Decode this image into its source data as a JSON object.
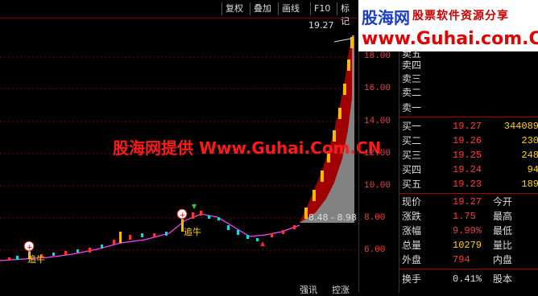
{
  "toolbar": {
    "items": [
      "复权",
      "叠加",
      "画线",
      "F10",
      "标记"
    ]
  },
  "logo": {
    "brand": "股海网",
    "slogan": "股票软件资源分享",
    "url": "www.Guhai.com.CN"
  },
  "chart": {
    "peak_label": "19.27",
    "range_label": "8.48 - 8.98",
    "signal_tags": [
      "追牛",
      "追牛"
    ],
    "bottom_tags": [
      "强讯",
      "控涨"
    ],
    "watermark": "股海网提供 Www.Guhai.Com.CN",
    "colors": {
      "up": "#ff3333",
      "down": "#00e0e0",
      "ma": "#ff44ff",
      "fill": "#a00000",
      "gold": "#ffb800"
    }
  },
  "price_axis": {
    "labels": [
      "18.00",
      "16.00",
      "14.00",
      "12.00",
      "10.00",
      "8.00",
      "6.00"
    ]
  },
  "quotes": {
    "sell": [
      {
        "label": "卖五",
        "price": "",
        "vol": ""
      },
      {
        "label": "卖四",
        "price": "",
        "vol": ""
      },
      {
        "label": "卖三",
        "price": "",
        "vol": ""
      },
      {
        "label": "卖二",
        "price": "",
        "vol": ""
      },
      {
        "label": "卖一",
        "price": "",
        "vol": ""
      }
    ],
    "buy": [
      {
        "label": "买一",
        "price": "19.27",
        "vol": "344089"
      },
      {
        "label": "买二",
        "price": "19.26",
        "vol": "230"
      },
      {
        "label": "买三",
        "price": "19.25",
        "vol": "248"
      },
      {
        "label": "买四",
        "price": "19.24",
        "vol": "94"
      },
      {
        "label": "买五",
        "price": "19.23",
        "vol": "189"
      }
    ],
    "stats": [
      {
        "label": "现价",
        "value": "19.27",
        "label2": "今开"
      },
      {
        "label": "涨跌",
        "value": "1.75",
        "label2": "最高"
      },
      {
        "label": "涨幅",
        "value": "9.99%",
        "label2": "最低"
      },
      {
        "label": "总量",
        "value": "10279",
        "label2": "量比"
      },
      {
        "label": "外盘",
        "value": "794",
        "label2": "内盘"
      },
      {
        "label": "换手",
        "value": "0.41%",
        "label2": "股本"
      }
    ]
  }
}
